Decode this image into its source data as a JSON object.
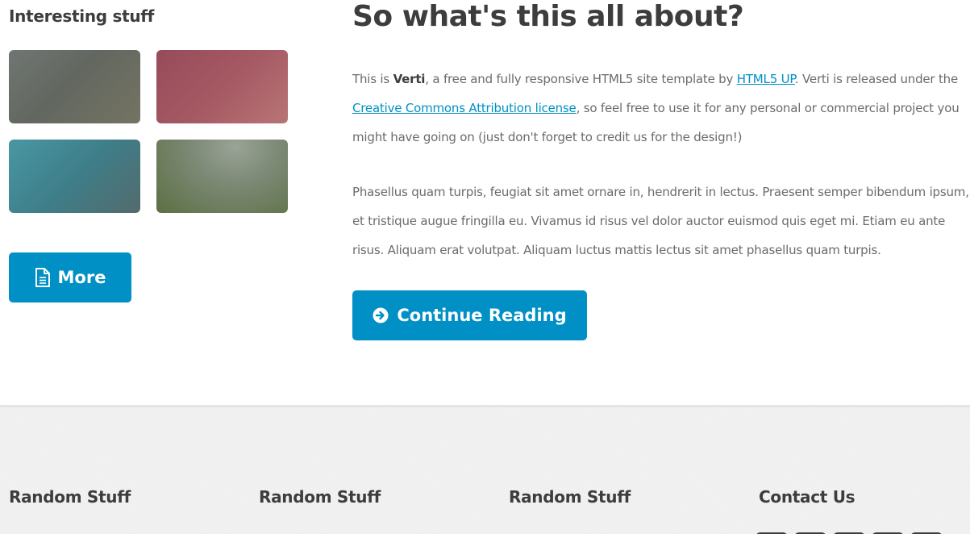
{
  "sidebar": {
    "title": "Interesting stuff",
    "thumbnails": [
      {
        "color": "#6b6f69"
      },
      {
        "color": "#a5596a"
      },
      {
        "color": "#4a8b95"
      },
      {
        "color": "#6e7d5e"
      }
    ],
    "more_label": "More",
    "more_icon": "document-icon"
  },
  "content": {
    "title": "So what's this all about?",
    "para1": {
      "t1": "This is ",
      "brand": "Verti",
      "t2": ", a free and fully responsive HTML5 site template by ",
      "link1": "HTML5 UP",
      "t3": ". Verti is released under the ",
      "link2": "Creative Commons Attribution license",
      "t4": ", so feel free to use it for any personal or commercial project you might have going on (just don't forget to credit us for the design!)"
    },
    "para2": "Phasellus quam turpis, feugiat sit amet ornare in, hendrerit in lectus. Praesent semper bibendum ipsum, et tristique augue fringilla eu. Vivamus id risus vel dolor auctor euismod quis eget mi. Etiam eu ante risus. Aliquam erat volutpat. Aliquam luctus mattis lectus sit amet phasellus quam turpis.",
    "continue_label": "Continue Reading",
    "continue_icon": "arrow-circle-right-icon"
  },
  "footer": {
    "columns": [
      {
        "title": "Random Stuff"
      },
      {
        "title": "Random Stuff"
      },
      {
        "title": "Random Stuff"
      },
      {
        "title": "Contact Us"
      }
    ]
  },
  "colors": {
    "accent": "#0090c5",
    "heading": "#3d3d3d",
    "body_text": "#6b6b6b",
    "footer_bg": "#efefef"
  }
}
